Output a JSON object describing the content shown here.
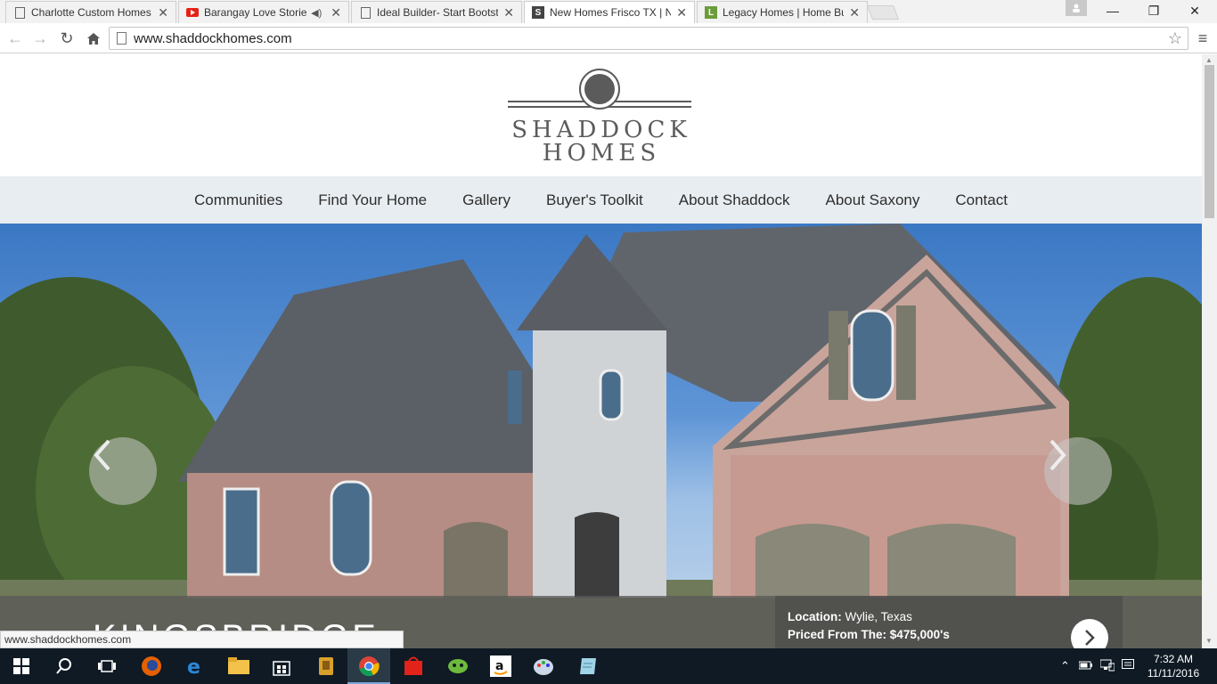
{
  "browser": {
    "tabs": [
      {
        "title": "Charlotte Custom Homes",
        "icon": "page-icon",
        "active": false
      },
      {
        "title": "Barangay Love Stories",
        "icon": "youtube-icon",
        "active": false,
        "audio": true
      },
      {
        "title": "Ideal Builder- Start Bootst",
        "icon": "page-icon",
        "active": false
      },
      {
        "title": "New Homes Frisco TX | Ne",
        "icon": "shaddock-s-icon",
        "active": true
      },
      {
        "title": "Legacy Homes | Home Bu",
        "icon": "legacy-l-icon",
        "active": false
      }
    ],
    "url": "www.shaddockhomes.com",
    "status_url": "www.shaddockhomes.com",
    "accent": "#7aa7d8"
  },
  "site": {
    "logo_line1": "SHADDOCK",
    "logo_line2": "HOMES",
    "nav": [
      "Communities",
      "Find Your Home",
      "Gallery",
      "Buyer's Toolkit",
      "About Shaddock",
      "About Saxony",
      "Contact"
    ],
    "slide": {
      "title": "KINGSBRIDGE",
      "location_label": "Location:",
      "location_value": "Wylie, Texas",
      "price_label": "Priced From The:",
      "price_value": "$475,000's"
    }
  },
  "taskbar": {
    "apps": [
      "windows-start-icon",
      "search-icon",
      "task-view-icon",
      "firefox-icon",
      "edge-icon",
      "file-explorer-icon",
      "store-icon",
      "app-icon",
      "chrome-icon",
      "shopping-icon",
      "app-green-icon",
      "amazon-icon",
      "paint-icon",
      "notes-icon"
    ],
    "time": "7:32 AM",
    "date": "11/11/2016"
  }
}
